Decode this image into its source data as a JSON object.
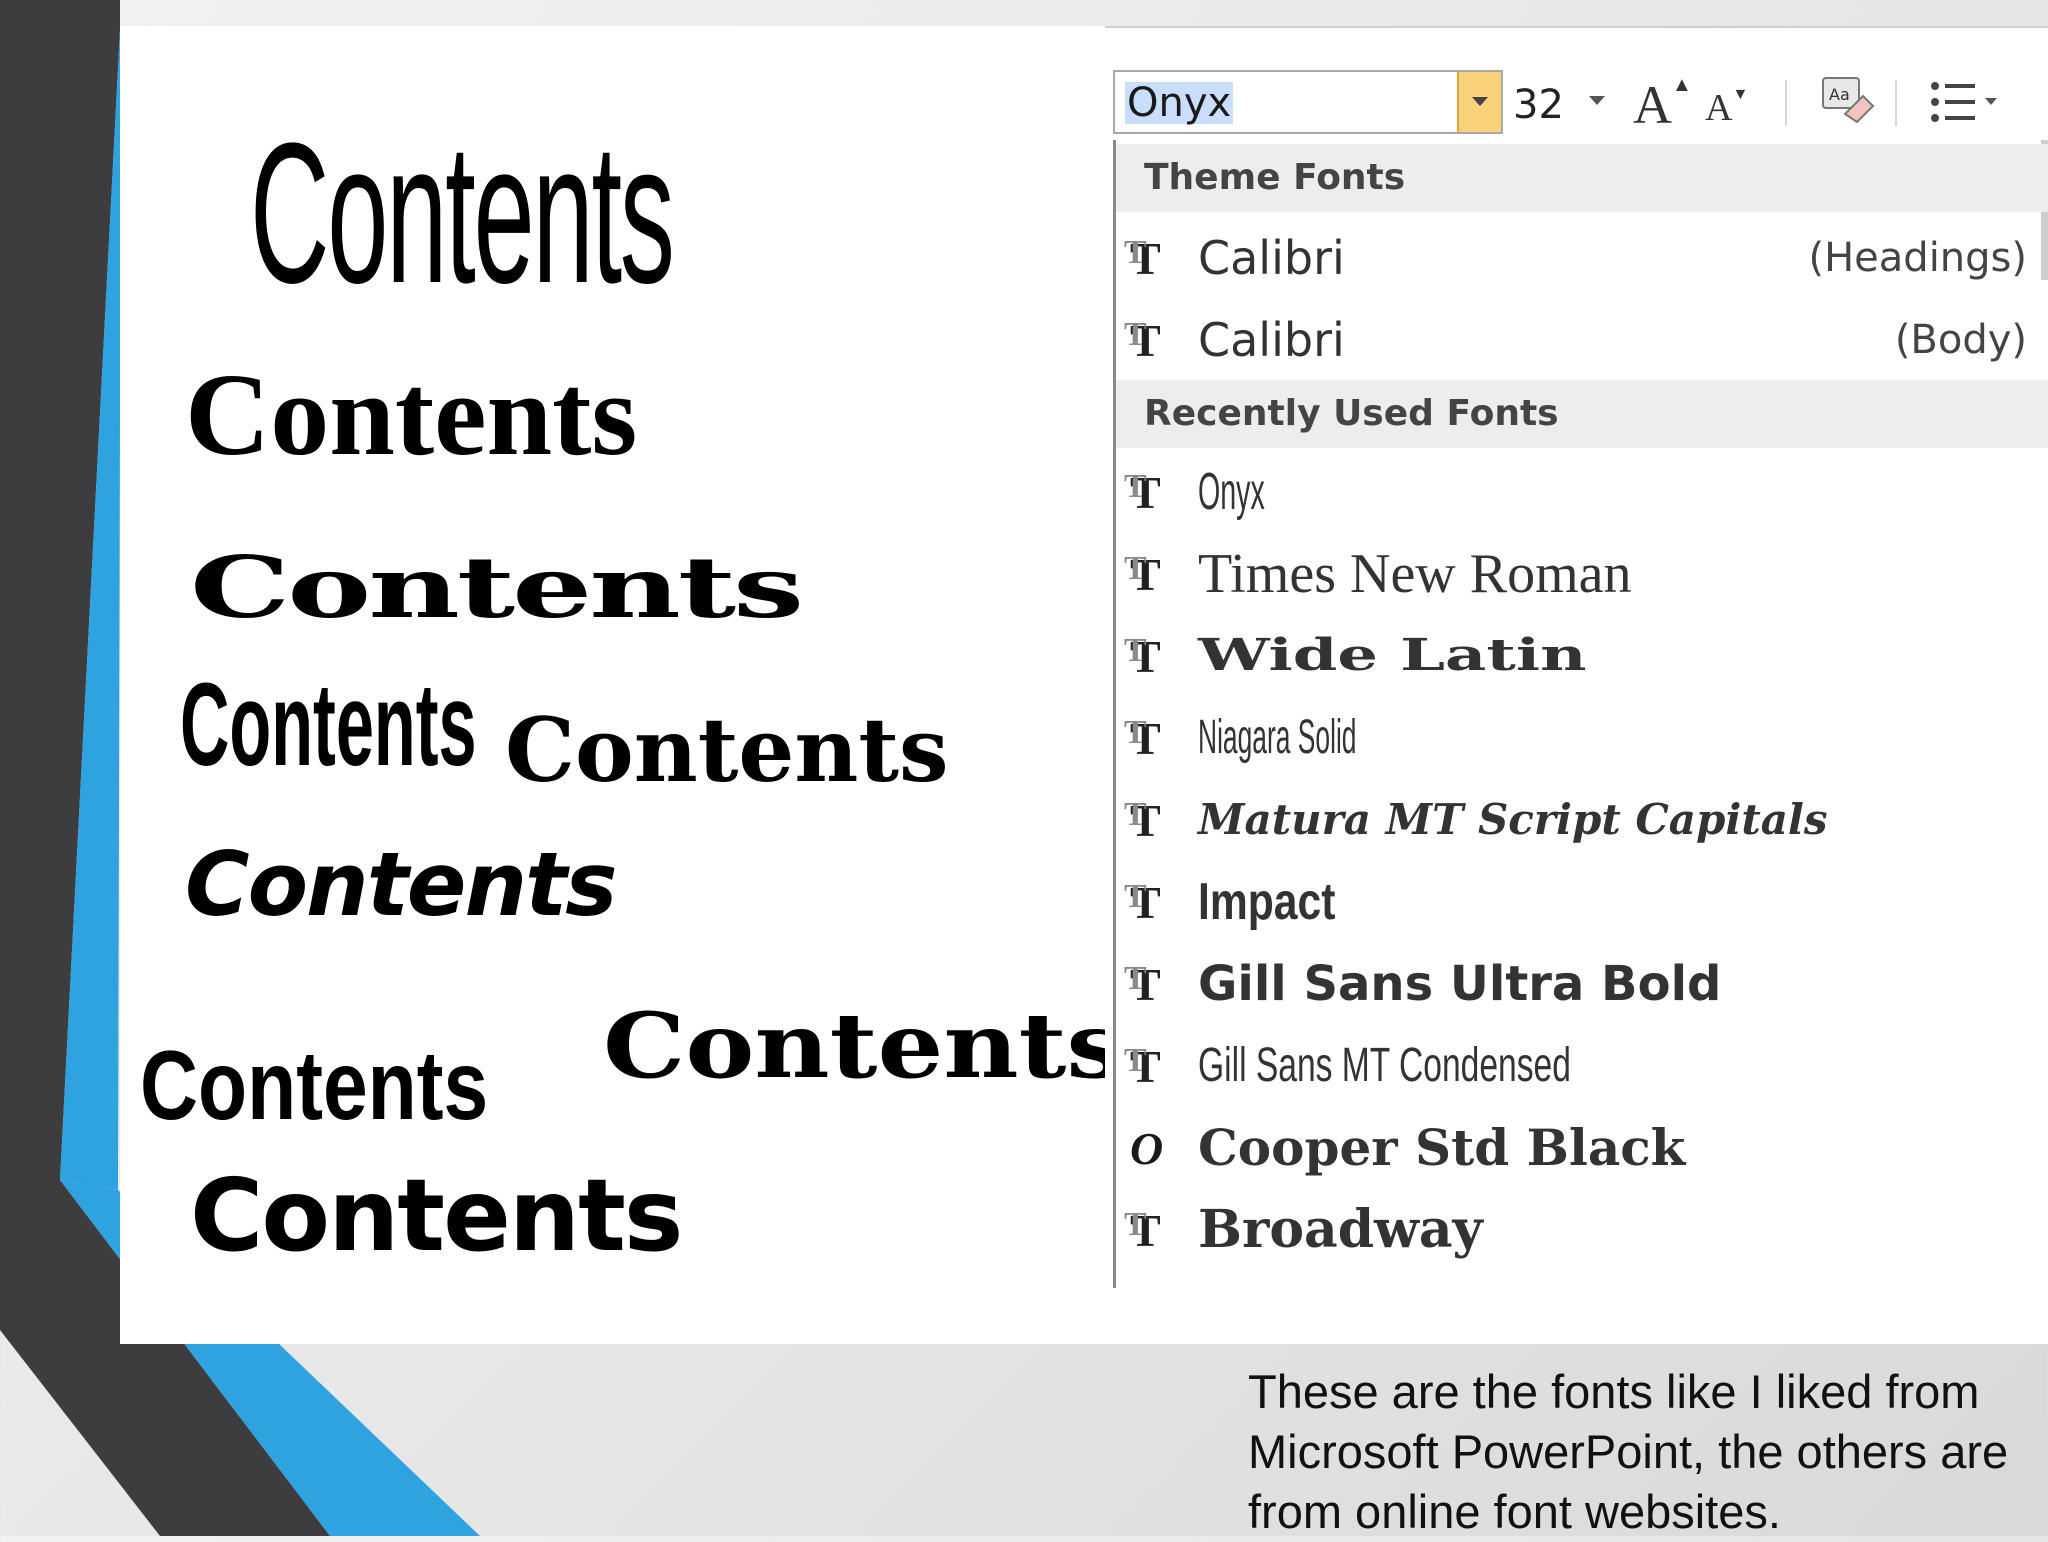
{
  "samples": [
    "Contents",
    "Contents",
    "Contents",
    "Contents",
    "Contents",
    "Contents",
    "Contents",
    "Contents",
    "Contents"
  ],
  "toolbar": {
    "font_value": "Onyx",
    "size_value": "32",
    "grow_icon": "grow-font-icon",
    "shrink_icon": "shrink-font-icon",
    "clear_icon": "clear-formatting-icon",
    "list_icon": "bullet-list-icon"
  },
  "dropdown": {
    "theme_header": "Theme Fonts",
    "theme_fonts": [
      {
        "name": "Calibri",
        "tag": "(Headings)"
      },
      {
        "name": "Calibri",
        "tag": "(Body)"
      }
    ],
    "recent_header": "Recently Used Fonts",
    "recent_fonts": [
      {
        "name": "Onyx",
        "icon": "truetype-icon"
      },
      {
        "name": "Times New Roman",
        "icon": "truetype-icon"
      },
      {
        "name": "Wide Latin",
        "icon": "truetype-icon"
      },
      {
        "name": "Niagara Solid",
        "icon": "truetype-icon"
      },
      {
        "name": "Matura MT Script Capitals",
        "icon": "truetype-icon"
      },
      {
        "name": "Impact",
        "icon": "truetype-icon"
      },
      {
        "name": "Gill Sans Ultra Bold",
        "icon": "truetype-icon"
      },
      {
        "name": "Gill Sans MT Condensed",
        "icon": "truetype-icon"
      },
      {
        "name": "Cooper Std Black",
        "icon": "opentype-icon"
      },
      {
        "name": "Broadway",
        "icon": "truetype-icon"
      }
    ]
  },
  "caption": "These are the fonts like I liked from Microsoft PowerPoint, the others are from online font websites.",
  "colors": {
    "accent_blue": "#2ea3e0",
    "dark_stripe": "#3d3d3f",
    "selection": "#c9defa",
    "combo_arrow": "#f9d27a"
  }
}
